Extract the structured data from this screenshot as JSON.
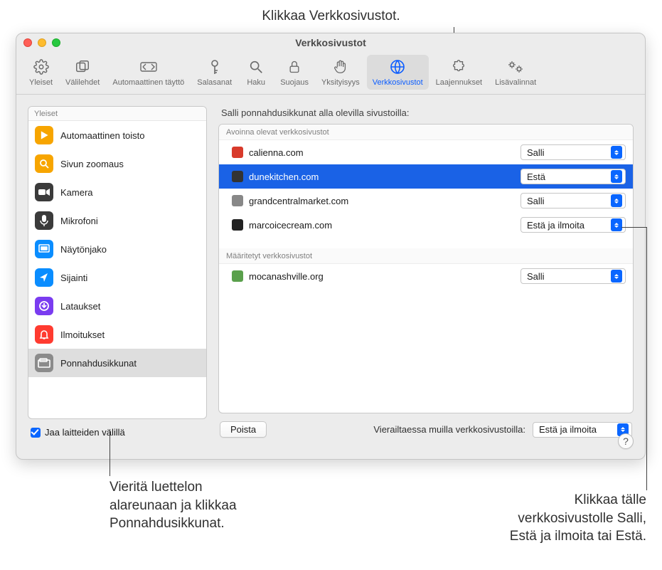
{
  "callouts": {
    "top": "Klikkaa Verkkosivustot.",
    "bottom_left_l1": "Vieritä luettelon",
    "bottom_left_l2": "alareunaan ja klikkaa",
    "bottom_left_l3": "Ponnahdusikkunat.",
    "bottom_right_l1": "Klikkaa tälle",
    "bottom_right_l2": "verkkosivustolle Salli,",
    "bottom_right_l3": "Estä ja ilmoita tai Estä."
  },
  "window": {
    "title": "Verkkosivustot"
  },
  "toolbar": {
    "items": [
      {
        "label": "Yleiset",
        "icon": "gear"
      },
      {
        "label": "Välilehdet",
        "icon": "tabs"
      },
      {
        "label": "Automaattinen täyttö",
        "icon": "autofill"
      },
      {
        "label": "Salasanat",
        "icon": "key"
      },
      {
        "label": "Haku",
        "icon": "search"
      },
      {
        "label": "Suojaus",
        "icon": "lock"
      },
      {
        "label": "Yksityisyys",
        "icon": "hand"
      },
      {
        "label": "Verkkosivustot",
        "icon": "globe",
        "active": true
      },
      {
        "label": "Laajennukset",
        "icon": "puzzle"
      },
      {
        "label": "Lisävalinnat",
        "icon": "gears"
      }
    ]
  },
  "sidebar": {
    "header": "Yleiset",
    "items": [
      {
        "label": "Automaattinen toisto",
        "color": "#f7a500"
      },
      {
        "label": "Sivun zoomaus",
        "color": "#f7a500"
      },
      {
        "label": "Kamera",
        "color": "#3b3b3b"
      },
      {
        "label": "Mikrofoni",
        "color": "#3b3b3b"
      },
      {
        "label": "Näytönjako",
        "color": "#0a8dff"
      },
      {
        "label": "Sijainti",
        "color": "#0a8dff"
      },
      {
        "label": "Lataukset",
        "color": "#7a3cf0"
      },
      {
        "label": "Ilmoitukset",
        "color": "#ff3b30"
      },
      {
        "label": "Ponnahdusikkunat",
        "color": "#8b8b8b",
        "active": true
      }
    ],
    "share": "Jaa laitteiden välillä"
  },
  "main": {
    "heading": "Salli ponnahdusikkunat alla olevilla sivustoilla:",
    "section_open": "Avoinna olevat verkkosivustot",
    "section_config": "Määritetyt verkkosivustot",
    "rows_open": [
      {
        "domain": "calienna.com",
        "opt": "Salli",
        "fcolor": "#d83a2b"
      },
      {
        "domain": "dunekitchen.com",
        "opt": "Estä",
        "selected": true,
        "fcolor": "#222"
      },
      {
        "domain": "grandcentralmarket.com",
        "opt": "Salli",
        "fcolor": "#888"
      },
      {
        "domain": "marcoicecream.com",
        "opt": "Estä ja ilmoita",
        "fcolor": "#222"
      }
    ],
    "rows_config": [
      {
        "domain": "mocanashville.org",
        "opt": "Salli",
        "fcolor": "#5aa04c"
      }
    ],
    "remove": "Poista",
    "other_label": "Vierailtaessa muilla verkkosivustoilla:",
    "other_opt": "Estä ja ilmoita"
  },
  "help": "?"
}
